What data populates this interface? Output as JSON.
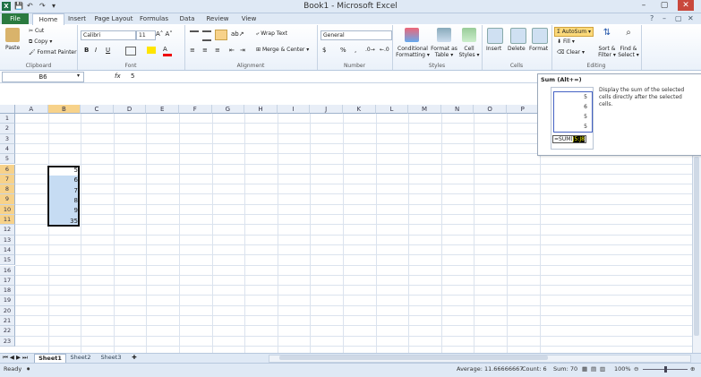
{
  "titlebar": {
    "title": "Book1 - Microsoft Excel",
    "app_icon": "X",
    "qat_icons": [
      "save-icon",
      "undo-icon",
      "redo-icon",
      "customize-icon"
    ],
    "window_buttons": [
      "–",
      "▢",
      "✕"
    ]
  },
  "ribbon_tabs": {
    "file": "File",
    "tabs": [
      "Home",
      "Insert",
      "Page Layout",
      "Formulas",
      "Data",
      "Review",
      "View"
    ],
    "active": "Home"
  },
  "ribbon": {
    "clipboard": {
      "label": "Clipboard",
      "paste": "Paste",
      "cut": "Cut",
      "copy": "Copy ▾",
      "format_painter": "Format Painter"
    },
    "font": {
      "label": "Font",
      "name": "Calibri",
      "size": "11",
      "bold": "B",
      "italic": "I",
      "underline": "U"
    },
    "alignment": {
      "label": "Alignment",
      "wrap": "Wrap Text",
      "merge": "Merge & Center ▾"
    },
    "number": {
      "label": "Number",
      "format": "General",
      "currency": "$",
      "percent": "%",
      "comma": ","
    },
    "styles": {
      "label": "Styles",
      "conditional": "Conditional Formatting ▾",
      "format_table": "Format as Table ▾",
      "cell_styles": "Cell Styles ▾"
    },
    "cells": {
      "label": "Cells",
      "insert": "Insert",
      "delete": "Delete",
      "format": "Format"
    },
    "editing": {
      "label": "Editing",
      "autosum": "Σ AutoSum ▾",
      "fill": "Fill ▾",
      "clear": "Clear ▾",
      "sort": "Sort & Filter ▾",
      "find": "Find & Select ▾"
    }
  },
  "formula_bar": {
    "name_box": "B6",
    "fx": "fx",
    "value": "5"
  },
  "columns": [
    "A",
    "B",
    "C",
    "D",
    "E",
    "F",
    "G",
    "H",
    "I",
    "J",
    "K",
    "L",
    "M",
    "N",
    "O",
    "P"
  ],
  "selected_column": "B",
  "rows": [
    "1",
    "2",
    "3",
    "4",
    "5",
    "6",
    "7",
    "8",
    "9",
    "10",
    "11",
    "12",
    "13",
    "14",
    "15",
    "16",
    "17",
    "18",
    "19",
    "20",
    "21",
    "22",
    "23"
  ],
  "selected_rows": [
    "6",
    "7",
    "8",
    "9",
    "10",
    "11"
  ],
  "cells": {
    "B6": "5",
    "B7": "6",
    "B8": "7",
    "B9": "8",
    "B10": "9",
    "B11": "35"
  },
  "tooltip": {
    "title": "Sum (Alt+=)",
    "description": "Display the sum of the selected cells directly after the selected cells.",
    "preview_values": [
      "5",
      "6",
      "5",
      "5"
    ],
    "preview_formula": "=SUM(",
    "preview_ref": "J5:J8"
  },
  "sheets": {
    "tabs": [
      "Sheet1",
      "Sheet2",
      "Sheet3"
    ],
    "active": "Sheet1"
  },
  "status": {
    "ready": "Ready",
    "average": "Average: 11.66666667",
    "count": "Count: 6",
    "sum": "Sum: 70",
    "zoom": "100%"
  }
}
